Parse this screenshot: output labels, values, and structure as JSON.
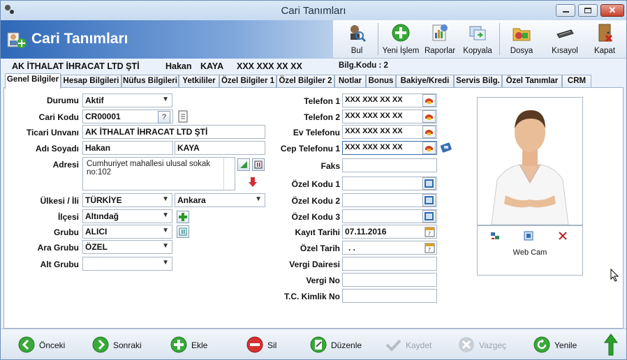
{
  "window": {
    "title": "Cari Tanımları"
  },
  "header": {
    "title": "Cari Tanımları"
  },
  "toolbar": {
    "bul": "Bul",
    "yeni": "Yeni İşlem",
    "raporlar": "Raporlar",
    "kopyala": "Kopyala",
    "dosya": "Dosya",
    "kisayol": "Kısayol",
    "kapat": "Kapat"
  },
  "info": {
    "company": "AK İTHALAT İHRACAT LTD ŞTİ",
    "first_name": "Hakan",
    "last_name": "KAYA",
    "phone": "XXX XXX XX XX",
    "bilg_kodu": "Bilg.Kodu : 2"
  },
  "tabs": [
    "Genel Bilgiler",
    "Hesap Bilgileri",
    "Nüfus Bilgileri",
    "Yetkililer",
    "Özel Bilgiler 1",
    "Özel Bilgiler 2",
    "Notlar",
    "Bonus",
    "Bakiye/Kredi",
    "Servis Bilg.",
    "Özel Tanımlar",
    "CRM"
  ],
  "left": {
    "durumu_label": "Durumu",
    "durumu_value": "Aktif",
    "cari_kodu_label": "Cari Kodu",
    "cari_kodu_value": "CR00001",
    "cari_kodu_btn": "?",
    "ticari_label": "Ticari Unvanı",
    "ticari_value": "AK İTHALAT İHRACAT LTD ŞTİ",
    "adsoyad_label": "Adı Soyadı",
    "ad_value": "Hakan",
    "soyad_value": "KAYA",
    "adres_label": "Adresi",
    "adres_value": "Cumhuriyet mahallesi ulusal sokak no:102",
    "ulke_label": "Ülkesi / İli",
    "ulke_value": "TÜRKİYE",
    "il_value": "Ankara",
    "ilce_label": "İlçesi",
    "ilce_value": "Altındağ",
    "grubu_label": "Grubu",
    "grubu_value": "ALICI",
    "ara_grubu_label": "Ara Grubu",
    "ara_grubu_value": "ÖZEL",
    "alt_grubu_label": "Alt Grubu",
    "alt_grubu_value": ""
  },
  "right": {
    "tel1_label": "Telefon 1",
    "tel1_value": "XXX XXX XX XX",
    "tel2_label": "Telefon 2",
    "tel2_value": "XXX XXX XX XX",
    "evtel_label": "Ev Telefonu",
    "evtel_value": "XXX XXX XX XX",
    "ceptel_label": "Cep Telefonu 1",
    "ceptel_value": "XXX XXX XX XX",
    "faks_label": "Faks",
    "faks_value": "",
    "ozel1_label": "Özel Kodu 1",
    "ozel2_label": "Özel Kodu 2",
    "ozel3_label": "Özel Kodu 3",
    "kayit_label": "Kayıt Tarihi",
    "kayit_value": "07.11.2016",
    "ozeltarih_label": "Özel Tarih",
    "ozeltarih_value": ". .",
    "vergidaire_label": "Vergi Dairesi",
    "vergino_label": "Vergi No",
    "tckimlik_label": "T.C. Kimlik No"
  },
  "webcam": {
    "label": "Web Cam"
  },
  "bottom": {
    "onceki": "Önceki",
    "sonraki": "Sonraki",
    "ekle": "Ekle",
    "sil": "Sil",
    "duzenle": "Düzenle",
    "kaydet": "Kaydet",
    "vazgec": "Vazgeç",
    "yenile": "Yenile"
  },
  "colors": {
    "header": "#2e68b8",
    "green": "#3aa83a",
    "red": "#d03030"
  }
}
